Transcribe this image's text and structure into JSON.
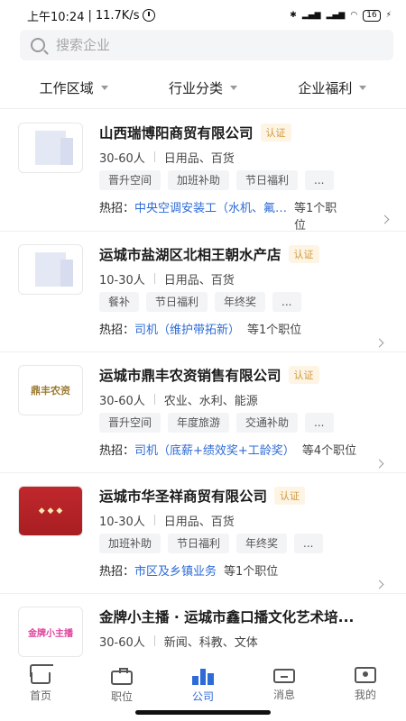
{
  "status_bar": {
    "time": "上午10:24",
    "network_speed": "11.7K/s",
    "battery": "16"
  },
  "search": {
    "placeholder": "搜索企业"
  },
  "filters": [
    {
      "label": "工作区域"
    },
    {
      "label": "行业分类"
    },
    {
      "label": "企业福利"
    }
  ],
  "companies": [
    {
      "name": "山西瑞博阳商贸有限公司",
      "certified": "认证",
      "size": "30-60人",
      "industry": "日用品、百货",
      "tags": [
        "晋升空间",
        "加班补助",
        "节日福利",
        "..."
      ],
      "hot_label": "热招：",
      "hot_job": "中央空调安装工（水机、氟…",
      "hot_count": "等1个职位"
    },
    {
      "name": "运城市盐湖区北相王朝水产店",
      "certified": "认证",
      "size": "10-30人",
      "industry": "日用品、百货",
      "tags": [
        "餐补",
        "节日福利",
        "年终奖",
        "..."
      ],
      "hot_label": "热招：",
      "hot_job": "司机（维护带拓新）",
      "hot_count": "等1个职位"
    },
    {
      "name": "运城市鼎丰农资销售有限公司",
      "certified": "认证",
      "size": "30-60人",
      "industry": "农业、水利、能源",
      "logo_text": "鼎丰农资",
      "tags": [
        "晋升空间",
        "年度旅游",
        "交通补助",
        "..."
      ],
      "hot_label": "热招：",
      "hot_job": "司机（底薪+绩效奖+工龄奖）",
      "hot_count": "等4个职位"
    },
    {
      "name": "运城市华圣祥商贸有限公司",
      "certified": "认证",
      "size": "10-30人",
      "industry": "日用品、百货",
      "tags": [
        "加班补助",
        "节日福利",
        "年终奖",
        "..."
      ],
      "hot_label": "热招：",
      "hot_job": "市区及乡镇业务",
      "hot_count": "等1个职位"
    },
    {
      "name": "金牌小主播 · 运城市鑫口播文化艺术培...",
      "size": "30-60人",
      "industry": "新闻、科教、文体",
      "logo_text": "金牌小主播"
    }
  ],
  "tab_bar": [
    {
      "label": "首页",
      "icon": "home-icon"
    },
    {
      "label": "职位",
      "icon": "briefcase-icon"
    },
    {
      "label": "公司",
      "icon": "company-icon"
    },
    {
      "label": "消息",
      "icon": "message-icon"
    },
    {
      "label": "我的",
      "icon": "profile-icon"
    }
  ],
  "colors": {
    "accent": "#2d6bd6",
    "cert_text": "#d1983a",
    "cert_bg": "#fdf4e4"
  }
}
